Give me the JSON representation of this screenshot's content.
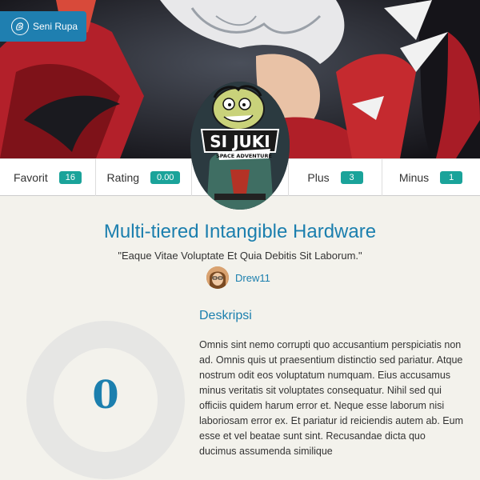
{
  "category": {
    "label": "Seni Rupa",
    "icon": "palette-icon"
  },
  "stats": {
    "favorit": {
      "label": "Favorit",
      "value": "16"
    },
    "rating": {
      "label": "Rating",
      "value": "0.00"
    },
    "plus": {
      "label": "Plus",
      "value": "3"
    },
    "minus": {
      "label": "Minus",
      "value": "1"
    }
  },
  "logo": {
    "line1": "SI JUKI",
    "line2": "SPACE ADVENTURE"
  },
  "title": "Multi-tiered Intangible Hardware",
  "quote": "\"Eaque Vitae Voluptate Et Quia Debitis Sit Laborum.\"",
  "author": {
    "name": "Drew11"
  },
  "score": {
    "value": "0"
  },
  "description": {
    "heading": "Deskripsi",
    "body": "Omnis sint nemo corrupti quo accusantium perspiciatis non ad. Omnis quis ut praesentium distinctio sed pariatur. Atque nostrum odit eos voluptatum numquam. Eius accusamus minus veritatis sit voluptates consequatur. Nihil sed qui officiis quidem harum error et. Neque esse laborum nisi laboriosam error ex. Et pariatur id reiciendis autem ab. Eum esse et vel beatae sunt sint. Recusandae dicta quo ducimus assumenda similique"
  },
  "colors": {
    "accent": "#1b7fae",
    "badge": "#1aa39a",
    "tag": "#1f7fb0"
  }
}
